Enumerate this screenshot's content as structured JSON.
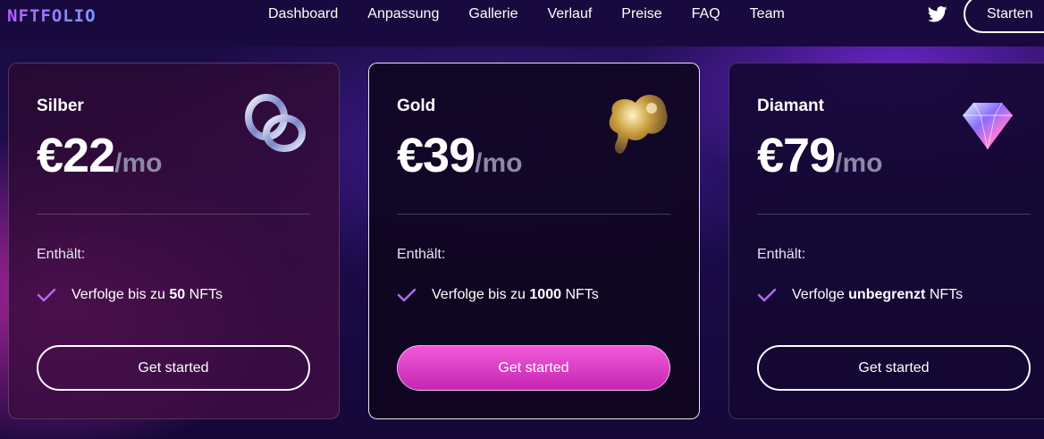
{
  "header": {
    "logo": "NFTFOLIO",
    "nav": [
      "Dashboard",
      "Anpassung",
      "Gallerie",
      "Verlauf",
      "Preise",
      "FAQ",
      "Team"
    ],
    "twitter_icon": "twitter-icon",
    "start_label": "Starten"
  },
  "plans": [
    {
      "name": "Silber",
      "price": "€22",
      "period": "/mo",
      "contains_label": "Enthält:",
      "feature_pre": "Verfolge bis zu ",
      "feature_bold": "50",
      "feature_post": " NFTs",
      "cta": "Get started",
      "art_icon": "silver-rings-icon"
    },
    {
      "name": "Gold",
      "price": "€39",
      "period": "/mo",
      "contains_label": "Enthält:",
      "feature_pre": "Verfolge bis zu ",
      "feature_bold": "1000",
      "feature_post": " NFTs",
      "cta": "Get started",
      "art_icon": "gold-blob-icon"
    },
    {
      "name": "Diamant",
      "price": "€79",
      "period": "/mo",
      "contains_label": "Enthält:",
      "feature_pre": "Verfolge ",
      "feature_bold": "unbegrenzt",
      "feature_post": " NFTs",
      "cta": "Get started",
      "art_icon": "diamond-icon"
    }
  ],
  "colors": {
    "accent_pink": "#e243cc",
    "check_purple": "#b06cf0",
    "background": "#1a0c44"
  }
}
